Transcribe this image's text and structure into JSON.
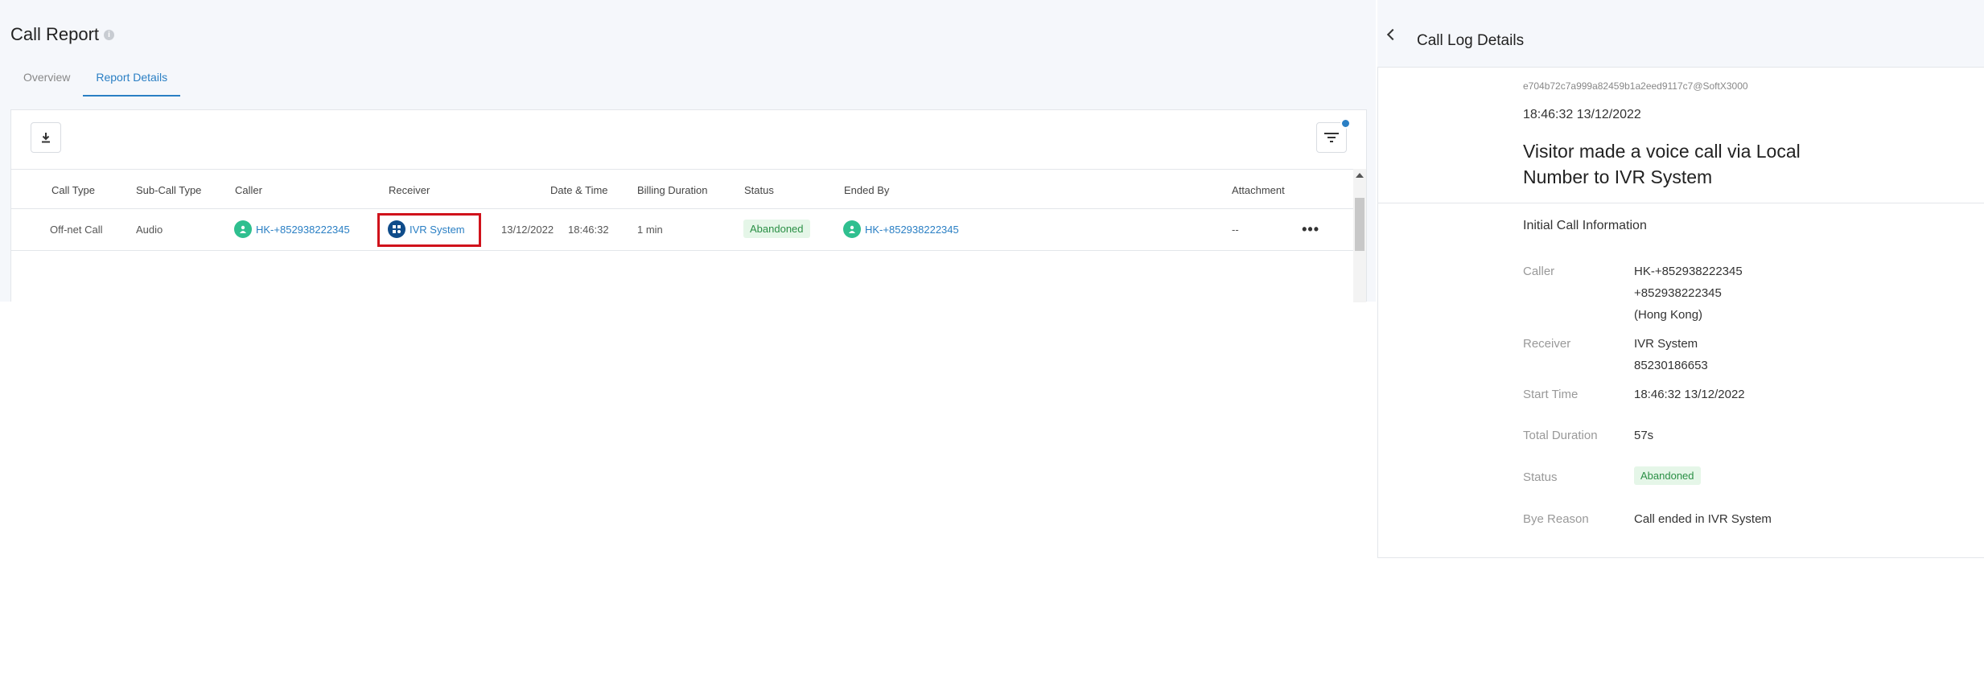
{
  "page": {
    "title": "Call Report",
    "tabs": [
      {
        "label": "Overview"
      },
      {
        "label": "Report Details"
      }
    ]
  },
  "table": {
    "columns": [
      "Call Type",
      "Sub-Call Type",
      "Caller",
      "Receiver",
      "Date & Time",
      "Billing Duration",
      "Status",
      "Ended By",
      "Attachment"
    ],
    "rows": [
      {
        "call_type": "Off-net Call",
        "sub_call_type": "Audio",
        "caller": "HK-+852938222345",
        "receiver": "IVR System",
        "date": "13/12/2022",
        "time": "18:46:32",
        "billing_duration": "1 min",
        "status": "Abandoned",
        "ended_by": "HK-+852938222345",
        "attachment": "--"
      }
    ]
  },
  "panel": {
    "title": "Call Log Details",
    "call_id": "e704b72c7a999a82459b1a2eed9117c7@SoftX3000",
    "timestamp": "18:46:32 13/12/2022",
    "summary": "Visitor made a voice call via Local Number to IVR System",
    "section_title": "Initial Call Information",
    "fields": {
      "caller_label": "Caller",
      "caller_line1": "HK-+852938222345",
      "caller_line2": "+852938222345",
      "caller_line3": "(Hong Kong)",
      "receiver_label": "Receiver",
      "receiver_line1": "IVR System",
      "receiver_line2": "85230186653",
      "start_time_label": "Start Time",
      "start_time": "18:46:32 13/12/2022",
      "total_duration_label": "Total Duration",
      "total_duration": "57s",
      "status_label": "Status",
      "status": "Abandoned",
      "bye_reason_label": "Bye Reason",
      "bye_reason": "Call ended in IVR System"
    }
  },
  "colors": {
    "accent": "#2a7fc4",
    "success_bg": "#e5f6e8",
    "success_text": "#2a8f45",
    "highlight": "#d0121b"
  },
  "icons": [
    "info-icon",
    "download-icon",
    "filter-icon",
    "user-icon",
    "ivr-icon",
    "more-icon",
    "back-icon"
  ]
}
